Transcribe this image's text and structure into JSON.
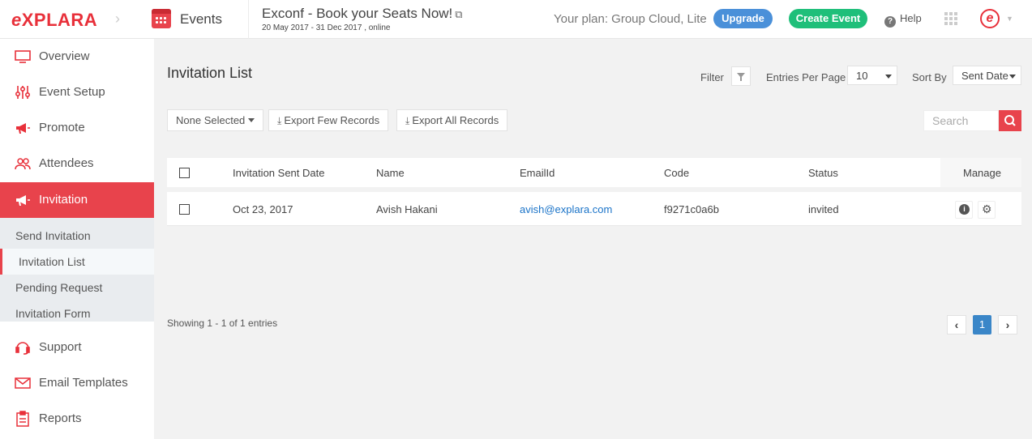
{
  "brand": {
    "logo_text": "EXPLARA",
    "logo_prefix": "e",
    "logo_rest": "XPLARA"
  },
  "header": {
    "section": "Events",
    "event_title": "Exconf - Book your Seats Now!",
    "event_date": "20 May 2017 - 31 Dec 2017 , online",
    "plan_text": "Your plan: Group Cloud, Lite",
    "upgrade_label": "Upgrade",
    "create_event_label": "Create Event",
    "help_label": "Help",
    "avatar_letter": "e"
  },
  "sidebar": {
    "items": [
      {
        "label": "Overview",
        "icon": "monitor-icon"
      },
      {
        "label": "Event Setup",
        "icon": "sliders-icon"
      },
      {
        "label": "Promote",
        "icon": "megaphone-icon"
      },
      {
        "label": "Attendees",
        "icon": "users-icon"
      },
      {
        "label": "Invitation",
        "icon": "megaphone-icon",
        "active": true
      },
      {
        "label": "Support",
        "icon": "headset-icon"
      },
      {
        "label": "Email Templates",
        "icon": "envelope-icon"
      },
      {
        "label": "Reports",
        "icon": "clipboard-icon"
      }
    ],
    "submenu": [
      {
        "label": "Send Invitation"
      },
      {
        "label": "Invitation List",
        "active": true
      },
      {
        "label": "Pending Request"
      },
      {
        "label": "Invitation Form"
      }
    ]
  },
  "main": {
    "title": "Invitation List",
    "filter_label": "Filter",
    "entries_label": "Entries Per Page",
    "entries_value": "10",
    "sort_label": "Sort By",
    "sort_value": "Sent Date",
    "none_selected_label": "None Selected",
    "export_few_label": "Export Few Records",
    "export_all_label": "Export All Records",
    "search_placeholder": "Search",
    "columns": [
      "Invitation Sent Date",
      "Name",
      "EmailId",
      "Code",
      "Status",
      "Manage"
    ],
    "rows": [
      {
        "date": "Oct 23, 2017",
        "name": "Avish Hakani",
        "email": "avish@explara.com",
        "code": "f9271c0a6b",
        "status": "invited"
      }
    ],
    "showing_text": "Showing 1 - 1 of 1 entries",
    "current_page": "1"
  },
  "colors": {
    "brand_red": "#e8434c",
    "upgrade_blue": "#4a90d9",
    "create_green": "#1fbf7a",
    "link_blue": "#1a73c8",
    "page_blue": "#3a86c8"
  }
}
